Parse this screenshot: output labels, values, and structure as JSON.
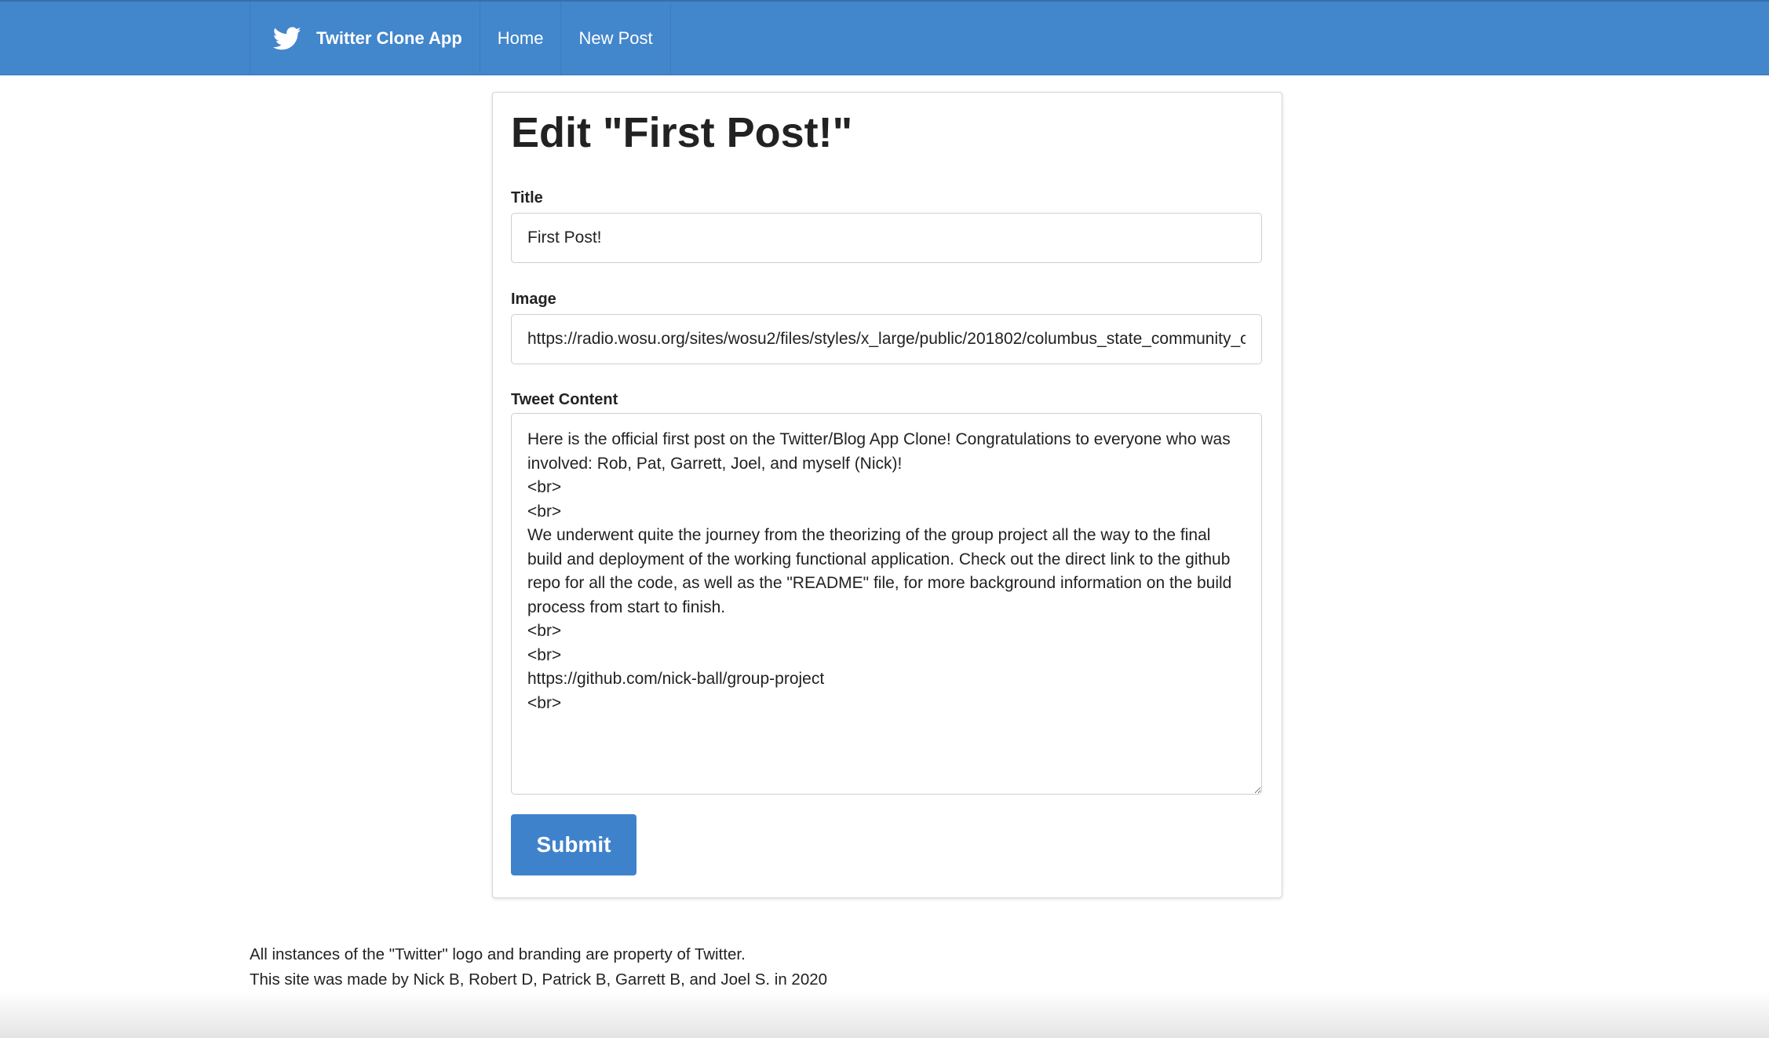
{
  "nav": {
    "brand": "Twitter Clone App",
    "links": [
      "Home",
      "New Post"
    ]
  },
  "form": {
    "heading": "Edit \"First Post!\"",
    "title_label": "Title",
    "title_value": "First Post!",
    "image_label": "Image",
    "image_value": "https://radio.wosu.org/sites/wosu2/files/styles/x_large/public/201802/columbus_state_community_colle",
    "content_label": "Tweet Content",
    "content_value": "Here is the official first post on the Twitter/Blog App Clone! Congratulations to everyone who was involved: Rob, Pat, Garrett, Joel, and myself (Nick)!\n<br>\n<br>\nWe underwent quite the journey from the theorizing of the group project all the way to the final build and deployment of the working functional application. Check out the direct link to the github repo for all the code, as well as the \"README\" file, for more background information on the build process from start to finish.\n<br>\n<br>\nhttps://github.com/nick-ball/group-project\n<br>",
    "submit_label": "Submit"
  },
  "footer": {
    "line1": "All instances of the \"Twitter\" logo and branding are property of Twitter.",
    "line2": "This site was made by Nick B, Robert D, Patrick B, Garrett B, and Joel S. in 2020"
  },
  "colors": {
    "navbar": "#4286cc",
    "button": "#3f82cc"
  },
  "icons": {
    "brand": "twitter-bird-icon"
  }
}
